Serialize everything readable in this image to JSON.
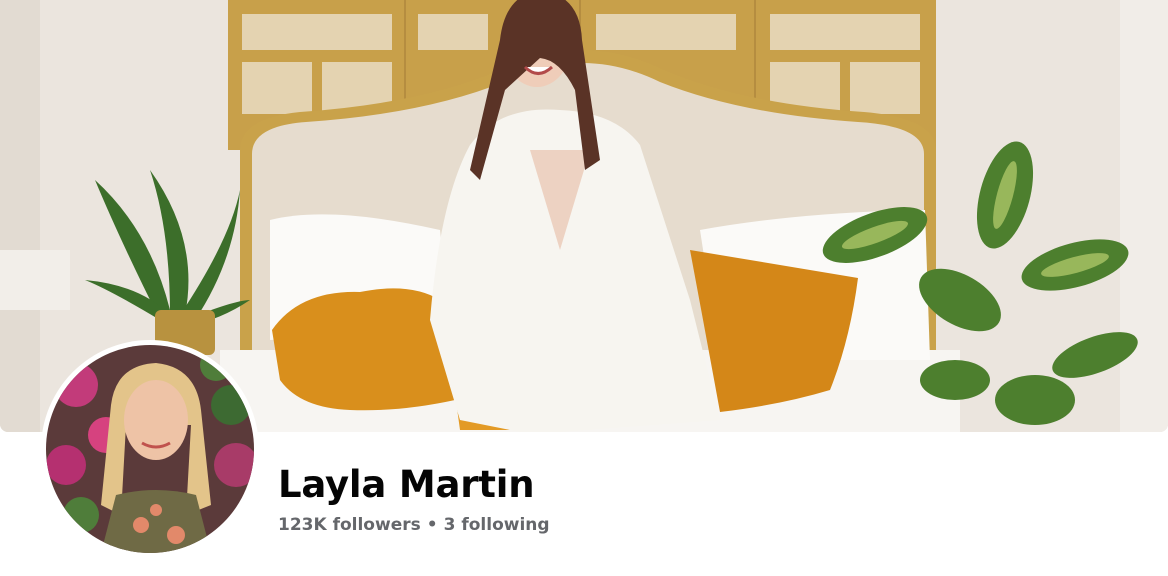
{
  "profile": {
    "name": "Layla Martin",
    "followers": "123K followers",
    "separator": "•",
    "following": "3 following"
  },
  "cover": {
    "description_icon": "cover-photo",
    "colors": {
      "wall": "#ece6df",
      "screen": "#c9a24a",
      "headboard": "#e8ddd0",
      "pillow_gold": "#d9901c",
      "suit": "#f6f4ef",
      "plant": "#3f7a2c"
    }
  },
  "avatar": {
    "icon": "profile-photo",
    "ring_color": "#ffffff"
  }
}
